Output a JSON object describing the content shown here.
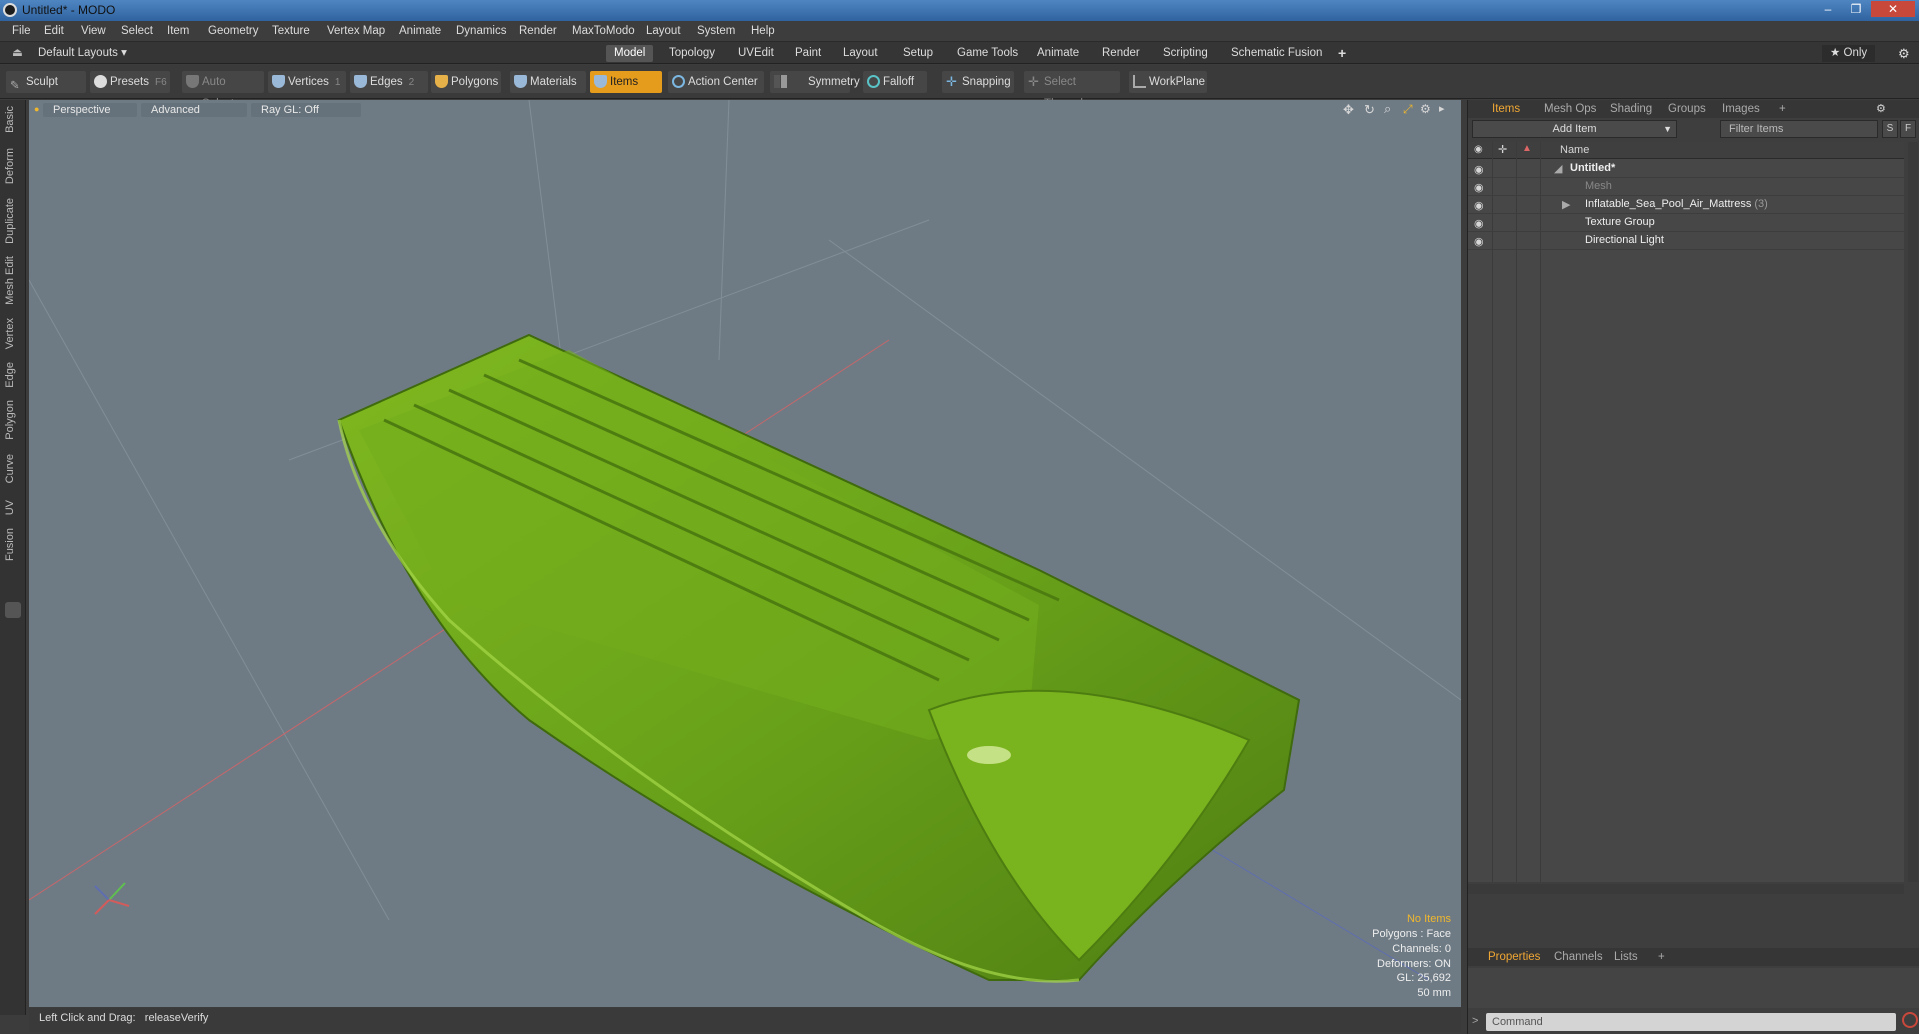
{
  "window": {
    "title": "Untitled* - MODO",
    "controls": {
      "minimize": "–",
      "maximize": "❐",
      "close": "✕"
    }
  },
  "menu": [
    "File",
    "Edit",
    "View",
    "Select",
    "Item",
    "Geometry",
    "Texture",
    "Vertex Map",
    "Animate",
    "Dynamics",
    "Render",
    "MaxToModo",
    "Layout",
    "System",
    "Help"
  ],
  "layout": {
    "selector": "Default Layouts ▾",
    "tabs": [
      "Model",
      "Topology",
      "UVEdit",
      "Paint",
      "Layout",
      "Setup",
      "Game Tools",
      "Animate",
      "Render",
      "Scripting",
      "Schematic Fusion"
    ],
    "active_tab": "Model",
    "add": "+",
    "only": "★  Only"
  },
  "toolbar": {
    "sculpt": "Sculpt",
    "presets": "Presets",
    "presets_key": "F6",
    "auto_select": "Auto Select",
    "vertices": "Vertices",
    "vertices_count": "1",
    "edges": "Edges",
    "edges_count": "2",
    "polygons": "Polygons",
    "materials": "Materials",
    "items": "Items",
    "action_center": "Action Center",
    "symmetry": "Symmetry",
    "falloff": "Falloff",
    "snapping": "Snapping",
    "select_through": "Select Through",
    "workplane": "WorkPlane"
  },
  "left_tabs": [
    "Basic",
    "Deform",
    "Duplicate",
    "Mesh Edit",
    "Vertex",
    "Edge",
    "Polygon",
    "Curve",
    "UV",
    "Fusion"
  ],
  "viewport": {
    "view": "Perspective",
    "shading": "Advanced",
    "raygl": "Ray GL: Off",
    "object_color": "#6aa31a",
    "stats": {
      "selection": "No Items",
      "polygons": "Polygons : Face",
      "channels": "Channels: 0",
      "deformers": "Deformers: ON",
      "gl": "GL: 25,692",
      "scale": "50 mm"
    }
  },
  "status": {
    "hint": "Left Click and Drag:",
    "action": "releaseVerify"
  },
  "items_panel": {
    "tabs": [
      "Items",
      "Mesh Ops",
      "Shading",
      "Groups",
      "Images",
      "+"
    ],
    "add_item": "Add Item",
    "filter": "Filter Items",
    "btn_s": "S",
    "btn_f": "F",
    "column": "Name",
    "rows": [
      {
        "name": "Untitled*",
        "indent": 0
      },
      {
        "name": "Mesh",
        "indent": 1
      },
      {
        "name": "Inflatable_Sea_Pool_Air_Mattress",
        "count": "(3)",
        "indent": 1
      },
      {
        "name": "Texture Group",
        "indent": 1
      },
      {
        "name": "Directional Light",
        "indent": 1
      }
    ]
  },
  "properties_panel": {
    "tabs": [
      "Properties",
      "Channels",
      "Lists",
      "+"
    ],
    "command_placeholder": "Command"
  }
}
